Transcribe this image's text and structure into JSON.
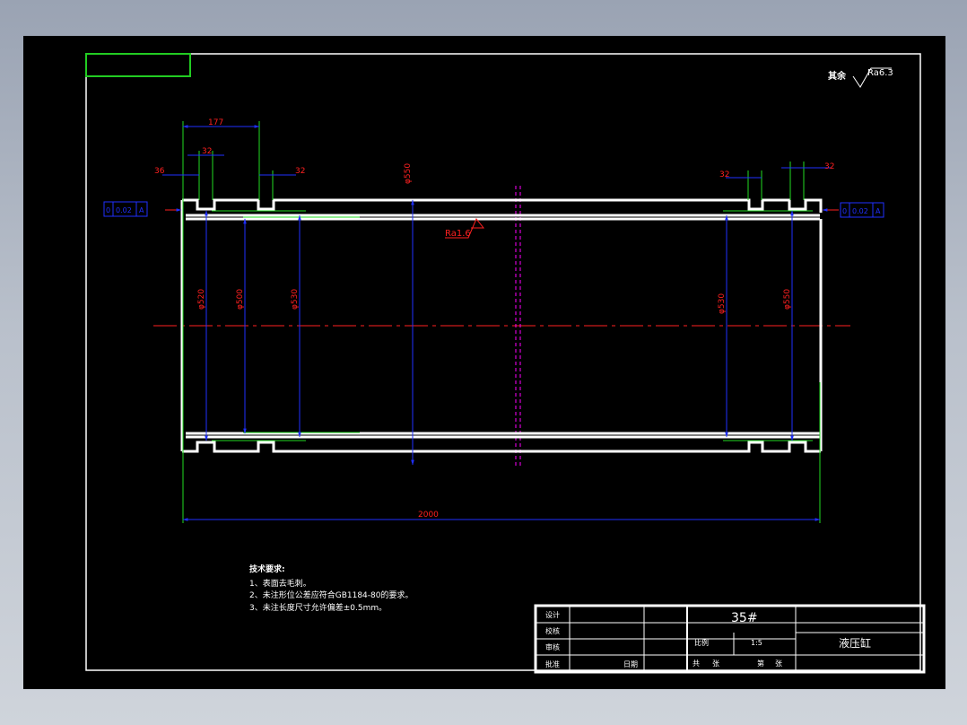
{
  "roughness": {
    "label": "其余",
    "value": "Ra6.3"
  },
  "dimensions": {
    "top_span": "177",
    "left_groove": "32",
    "left_offset": "36",
    "left_mid_groove": "32",
    "right_left_groove": "32",
    "right_groove": "32",
    "outer_dia": "φ550",
    "length": "2000",
    "dia_l1": "φ520",
    "dia_l2": "φ500",
    "dia_l3": "φ530",
    "dia_r1": "φ530",
    "dia_r2": "φ550"
  },
  "tolerance": {
    "left": [
      "0",
      "0.02",
      "A"
    ],
    "right": [
      "0",
      "0.02",
      "A"
    ]
  },
  "inner_roughness": "Ra1.6",
  "tech_requirements": {
    "title": "技术要求:",
    "lines": [
      "1、表面去毛刺。",
      "2、未注形位公差应符合GB1184-80的要求。",
      "3、未注长度尺寸允许偏差±0.5mm。"
    ]
  },
  "title_block": {
    "design": "设计",
    "check": "校核",
    "review": "审核",
    "approve": "批准",
    "date": "日期",
    "material": "35#",
    "scale_label": "比例",
    "scale_value": "1:5",
    "part_name": "液压缸",
    "total_label": "共",
    "sheet_label": "张",
    "page_label": "第",
    "page_sheet_label": "张"
  },
  "colors": {
    "sheet": "#000000",
    "part": "#ffffff",
    "dimension": "#0000ff",
    "dim_text": "#ff0000",
    "center": "#ff0000",
    "extension": "#00ff00",
    "section": "#ff00ff"
  }
}
